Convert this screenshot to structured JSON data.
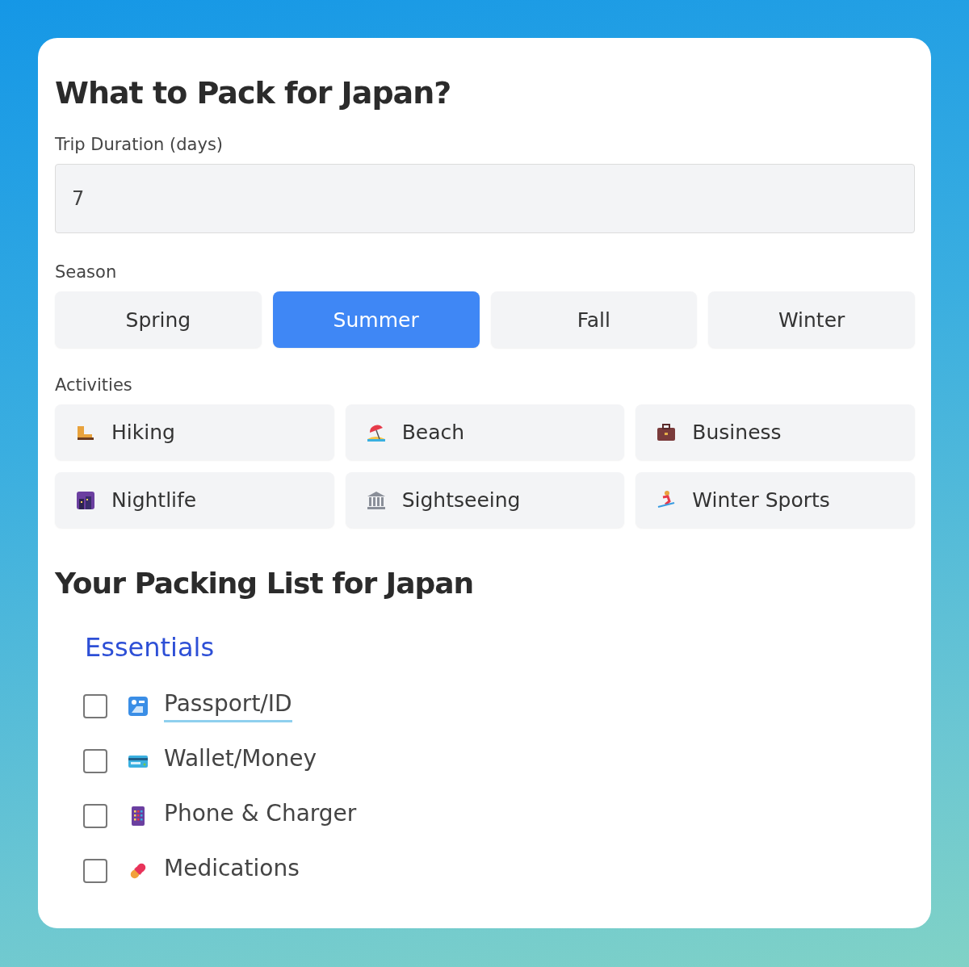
{
  "title": "What to Pack for Japan?",
  "duration": {
    "label": "Trip Duration (days)",
    "value": "7"
  },
  "season": {
    "label": "Season",
    "options": [
      {
        "label": "Spring",
        "selected": false
      },
      {
        "label": "Summer",
        "selected": true
      },
      {
        "label": "Fall",
        "selected": false
      },
      {
        "label": "Winter",
        "selected": false
      }
    ]
  },
  "activities": {
    "label": "Activities",
    "options": [
      {
        "label": "Hiking",
        "selected": false
      },
      {
        "label": "Beach",
        "selected": false
      },
      {
        "label": "Business",
        "selected": false
      },
      {
        "label": "Nightlife",
        "selected": false
      },
      {
        "label": "Sightseeing",
        "selected": false
      },
      {
        "label": "Winter Sports",
        "selected": false
      }
    ]
  },
  "packing_list": {
    "title": "Your Packing List for Japan",
    "sections": [
      {
        "title": "Essentials",
        "items": [
          {
            "label": "Passport/ID",
            "checked": false,
            "focused": true
          },
          {
            "label": "Wallet/Money",
            "checked": false,
            "focused": false
          },
          {
            "label": "Phone & Charger",
            "checked": false,
            "focused": false
          },
          {
            "label": "Medications",
            "checked": false,
            "focused": false
          }
        ]
      }
    ]
  }
}
